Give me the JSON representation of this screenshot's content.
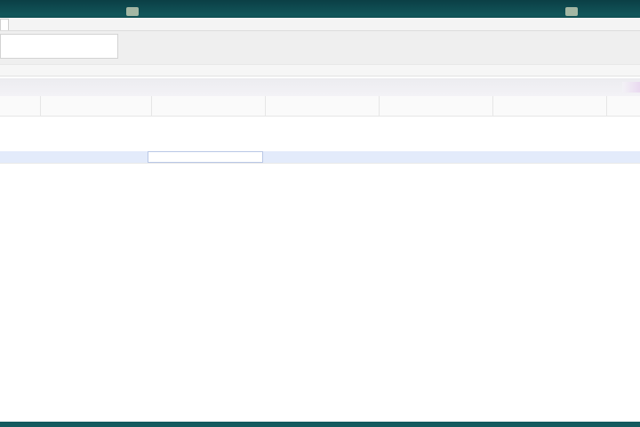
{
  "window": {
    "tab_label": ""
  },
  "info_panel": {
    "rows": [
      {
        "label": "",
        "value": ""
      },
      {
        "label": "",
        "value": ""
      }
    ]
  },
  "filter": {
    "hint": ""
  },
  "grid": {
    "columns": [
      "",
      "",
      "",
      "",
      "",
      "",
      "",
      ""
    ],
    "rows": [
      {
        "cells": [
          "",
          "",
          "",
          "",
          "",
          "",
          "",
          ""
        ]
      },
      {
        "cells": [
          "",
          "",
          "",
          "",
          "",
          "",
          "",
          ""
        ]
      }
    ]
  },
  "colors": {
    "wallpaper": "#0f4a4f",
    "selection": "#e3ebfb",
    "window": "#ffffff"
  }
}
